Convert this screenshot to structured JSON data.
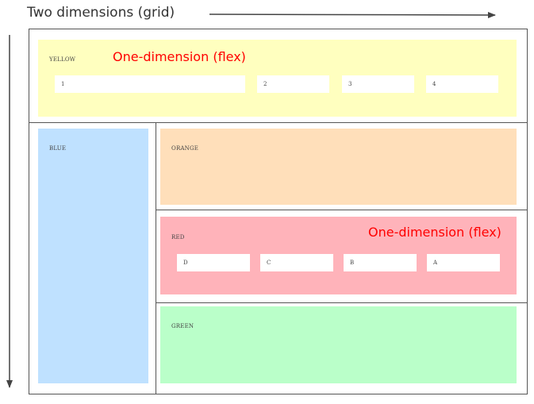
{
  "heading": "Two dimensions (grid)",
  "flex_annotation_top": "One-dimension (flex)",
  "flex_annotation_red": "One-dimension (flex)",
  "colors": {
    "yellow": "#ffffbf",
    "blue": "#bfe1ff",
    "orange": "#ffdfba",
    "red": "#ffb3ba",
    "green": "#baffc9",
    "annotation": "#ff0000",
    "border": "#555555"
  },
  "panels": {
    "yellow": {
      "label": "YELLOW",
      "items": [
        "1",
        "2",
        "3",
        "4"
      ]
    },
    "blue": {
      "label": "BLUE"
    },
    "orange": {
      "label": "ORANGE"
    },
    "red": {
      "label": "RED",
      "items": [
        "D",
        "C",
        "B",
        "A"
      ]
    },
    "green": {
      "label": "GREEN"
    }
  }
}
